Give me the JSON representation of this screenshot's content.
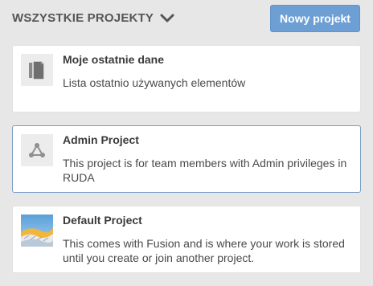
{
  "header": {
    "title": "WSZYSTKIE PROJEKTY",
    "new_project_label": "Nowy projekt"
  },
  "projects": [
    {
      "title": "Moje ostatnie dane",
      "description": "Lista ostatnio używanych elementów",
      "icon": "recent-documents-icon"
    },
    {
      "title": "Admin Project",
      "description": "This project is for team members with Admin privileges in RUDA",
      "icon": "project-network-icon",
      "selected": true
    },
    {
      "title": "Default Project",
      "description": "This comes with Fusion and is where your work is stored until you create or join another project.",
      "icon": "project-thumbnail-image"
    }
  ],
  "colors": {
    "background": "#e7e7e7",
    "primary_button": "#6e9fd4",
    "selected_border": "#7b9ec5"
  }
}
